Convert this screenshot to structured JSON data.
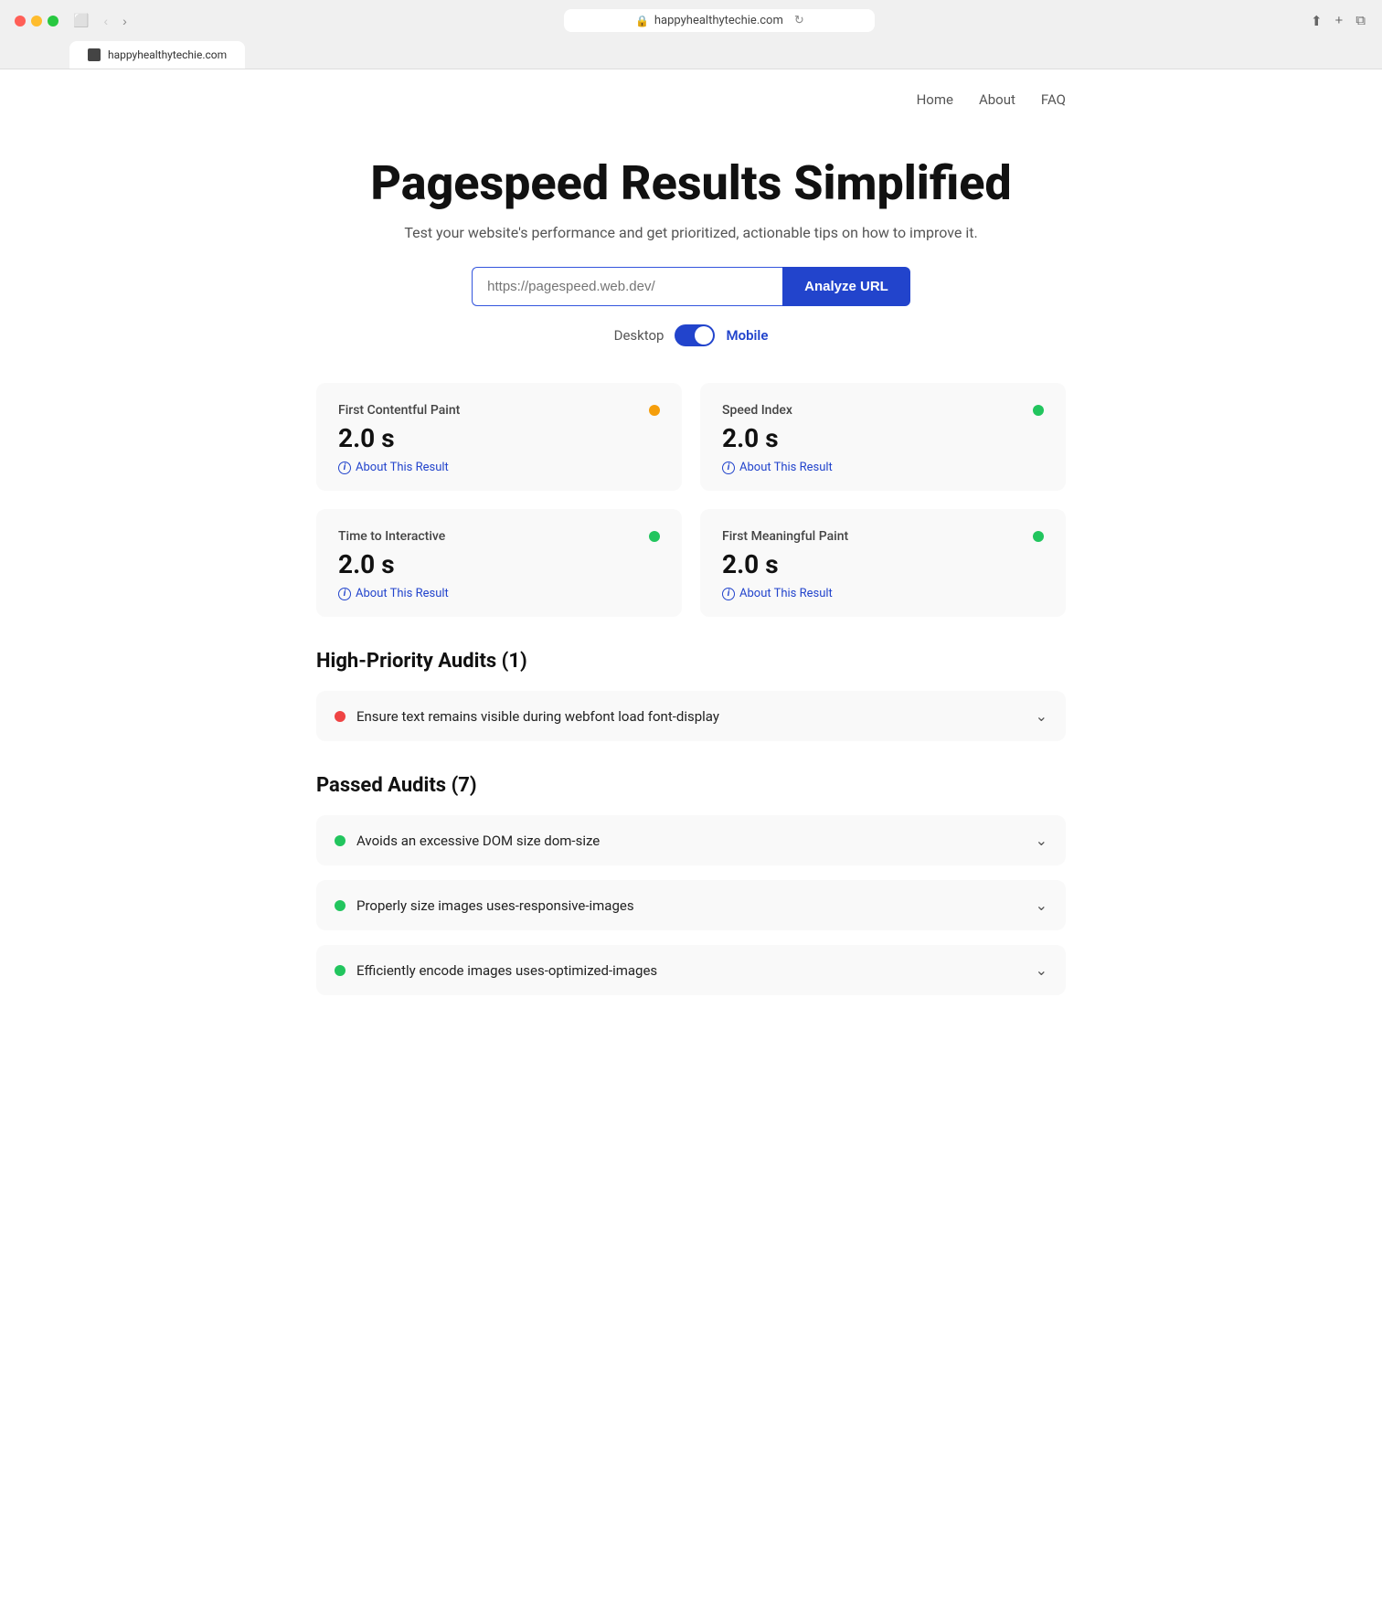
{
  "browser": {
    "tab_title": "happyhealthytechie.com",
    "address": "happyhealthytechie.com",
    "lock_icon": "🔒"
  },
  "nav": {
    "items": [
      {
        "label": "Home",
        "href": "#"
      },
      {
        "label": "About",
        "href": "#"
      },
      {
        "label": "FAQ",
        "href": "#"
      }
    ]
  },
  "hero": {
    "title": "Pagespeed Results Simplified",
    "subtitle": "Test your website's performance and get prioritized, actionable tips on how to improve it.",
    "url_input_value": "https://pagespeed.web.dev/",
    "url_input_placeholder": "https://pagespeed.web.dev/",
    "analyze_button": "Analyze URL",
    "toggle_desktop": "Desktop",
    "toggle_mobile": "Mobile"
  },
  "metrics": [
    {
      "title": "First Contentful Paint",
      "value": "2.0 s",
      "dot_color": "dot-orange",
      "about_label": "About This Result"
    },
    {
      "title": "Speed Index",
      "value": "2.0 s",
      "dot_color": "dot-green",
      "about_label": "About This Result"
    },
    {
      "title": "Time to Interactive",
      "value": "2.0 s",
      "dot_color": "dot-green",
      "about_label": "About This Result"
    },
    {
      "title": "First Meaningful Paint",
      "value": "2.0 s",
      "dot_color": "dot-green",
      "about_label": "About This Result"
    }
  ],
  "high_priority": {
    "title": "High-Priority Audits (1)",
    "items": [
      {
        "text": "Ensure text remains visible during webfont load font-display",
        "dot_color": "#ef4444"
      }
    ]
  },
  "passed_audits": {
    "title": "Passed Audits (7)",
    "items": [
      {
        "text": "Avoids an excessive DOM size dom-size",
        "dot_color": "#22c55e"
      },
      {
        "text": "Properly size images uses-responsive-images",
        "dot_color": "#22c55e"
      },
      {
        "text": "Efficiently encode images uses-optimized-images",
        "dot_color": "#22c55e"
      }
    ]
  }
}
